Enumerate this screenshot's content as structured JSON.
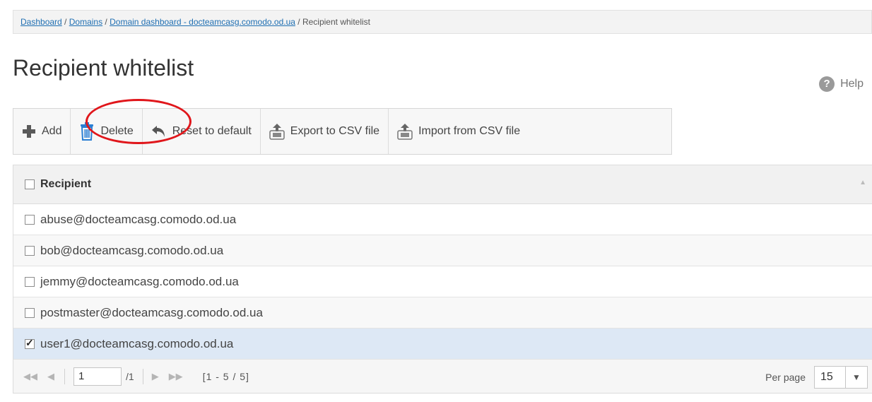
{
  "breadcrumb": {
    "items": [
      "Dashboard",
      "Domains",
      "Domain dashboard - docteamcasg.comodo.od.ua"
    ],
    "separator": " / ",
    "current": "Recipient whitelist"
  },
  "page_title": "Recipient whitelist",
  "help_label": "Help",
  "toolbar": {
    "add": "Add",
    "delete": "Delete",
    "reset": "Reset to default",
    "export": "Export to CSV file",
    "import": "Import from CSV file"
  },
  "grid": {
    "column": "Recipient",
    "rows": [
      {
        "email": "abuse@docteamcasg.comodo.od.ua",
        "checked": false
      },
      {
        "email": "bob@docteamcasg.comodo.od.ua",
        "checked": false
      },
      {
        "email": "jemmy@docteamcasg.comodo.od.ua",
        "checked": false
      },
      {
        "email": "postmaster@docteamcasg.comodo.od.ua",
        "checked": false
      },
      {
        "email": "user1@docteamcasg.comodo.od.ua",
        "checked": true
      }
    ]
  },
  "pager": {
    "page": "1",
    "total_pages": "/1",
    "range": "[1 - 5 / 5]",
    "per_page_label": "Per page",
    "per_page_value": "15"
  },
  "colors": {
    "link": "#1f6fb2",
    "highlight_ellipse": "#e0161b",
    "selected_row": "#dde8f5",
    "add_icon": "#5a5a5a",
    "delete_icon": "#2a7fd4"
  }
}
